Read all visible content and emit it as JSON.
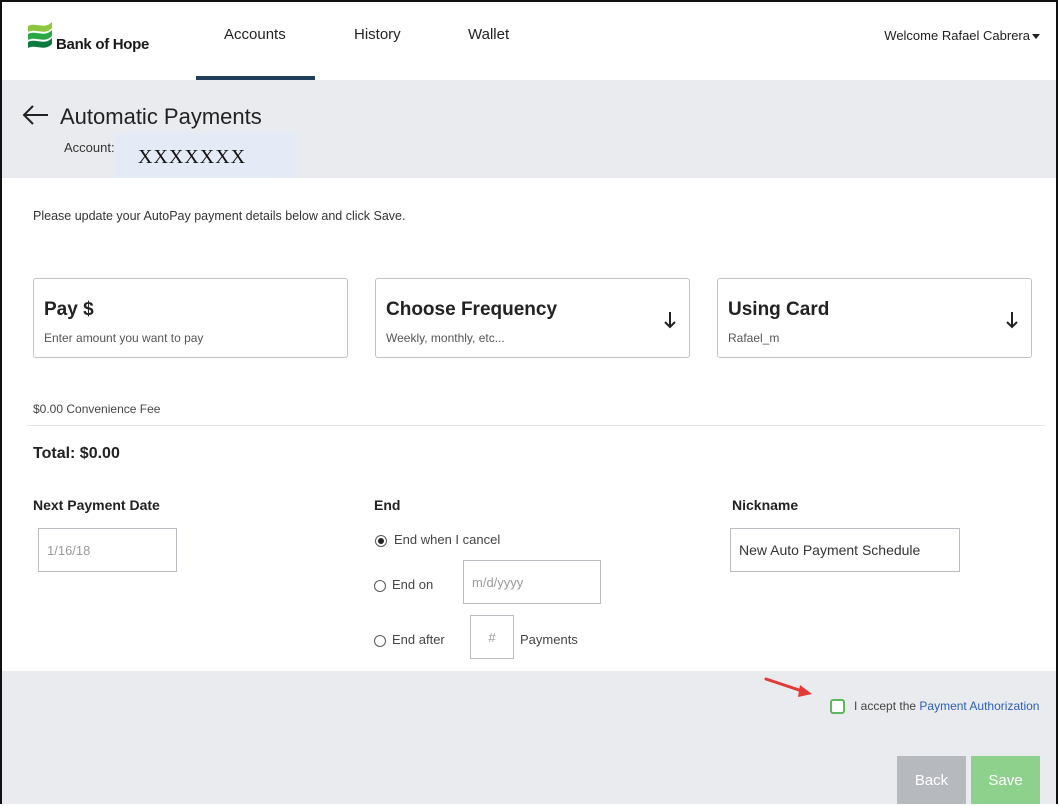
{
  "header": {
    "brand": "Bank of Hope",
    "nav": [
      "Accounts",
      "History",
      "Wallet"
    ],
    "active_nav": "Accounts",
    "welcome": "Welcome Rafael Cabrera"
  },
  "title_band": {
    "title": "Automatic Payments",
    "account_label": "Account:",
    "account_value": "XXXXXXX"
  },
  "instructions": "Please update your AutoPay payment details below and click Save.",
  "cards": {
    "pay": {
      "title": "Pay $",
      "subtitle": "Enter amount you want to pay"
    },
    "frequency": {
      "title": "Choose Frequency",
      "subtitle": "Weekly, monthly, etc..."
    },
    "card": {
      "title": "Using Card",
      "subtitle": "Rafael_m"
    }
  },
  "fee": "$0.00 Convenience Fee",
  "total": "Total: $0.00",
  "next_payment": {
    "label": "Next Payment Date",
    "value": "1/16/18"
  },
  "end": {
    "label": "End",
    "options": [
      "End when I cancel",
      "End on",
      "End after"
    ],
    "selected": "End when I cancel",
    "date_placeholder": "m/d/yyyy",
    "count_placeholder": "#",
    "payments_label": "Payments"
  },
  "nickname": {
    "label": "Nickname",
    "value": "New Auto Payment Schedule"
  },
  "accept": {
    "prefix": "I accept the",
    "link": "Payment Authorization"
  },
  "buttons": {
    "back": "Back",
    "save": "Save"
  },
  "colors": {
    "nav_underline": "#1f3f5b",
    "band": "#e9ebee",
    "link": "#2b5fb4",
    "checkbox": "#5cb85c",
    "save": "#8ed18c",
    "back": "#b6b9bd",
    "annotation_arrow": "#e53935"
  },
  "icons": [
    "bank-of-hope-logo",
    "back-arrow-icon",
    "arrow-down-icon",
    "annotation-arrow-icon"
  ]
}
